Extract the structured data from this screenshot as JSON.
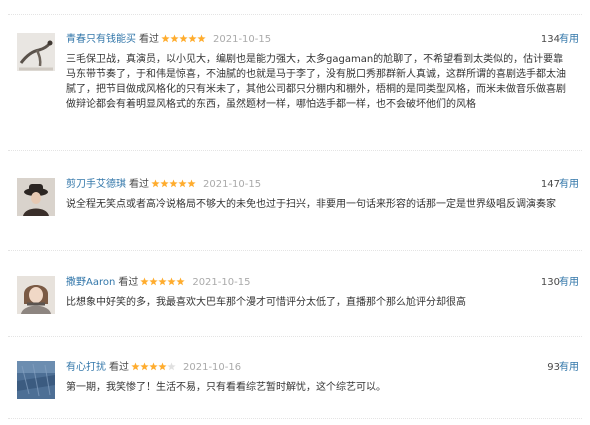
{
  "reviews": [
    {
      "user": "青春只有钱能买",
      "action": "看过",
      "rating": 5,
      "time": "2021-10-15",
      "votes": "134",
      "useful_label": "有用",
      "text": "三毛保卫战，真演员，以小见大，编剧也是能力强大，太多gagaman的尬聊了，不希望看到太类似的，估计要靠马东带节奏了，于和伟是惊喜，不油腻的也就是马于李了，没有脱口秀那群新人真诚，这群所谓的喜剧选手都太油腻了，把节目做成风格化的只有米未了，其他公司都只分棚内和棚外，梧桐的是同类型风格，而米未做音乐做喜剧做辩论都会有着明显风格式的东西，虽然题材一样，哪怕选手都一样，也不会破坏他们的风格"
    },
    {
      "user": "剪刀手艾德琪",
      "action": "看过",
      "rating": 5,
      "time": "2021-10-15",
      "votes": "147",
      "useful_label": "有用",
      "text": "说全程无笑点或者高冷说格局不够大的未免也过于扫兴，非要用一句话来形容的话那一定是世界级唱反调演奏家"
    },
    {
      "user": "撒野Aaron",
      "action": "看过",
      "rating": 5,
      "time": "2021-10-15",
      "votes": "130",
      "useful_label": "有用",
      "text": "比想象中好笑的多，我最喜欢大巴车那个漫才可惜评分太低了，直播那个那么尬评分却很高"
    },
    {
      "user": "有心打扰",
      "action": "看过",
      "rating": 4,
      "time": "2021-10-16",
      "votes": "93",
      "useful_label": "有用",
      "text": "第一期，我笑惨了！生活不易，只有看看综艺暂时解忧，这个综艺可以。"
    }
  ],
  "colors": {
    "link": "#3377aa",
    "star_filled": "#ffac2d",
    "star_empty": "#e0e0e0",
    "time": "#aaaaaa"
  }
}
